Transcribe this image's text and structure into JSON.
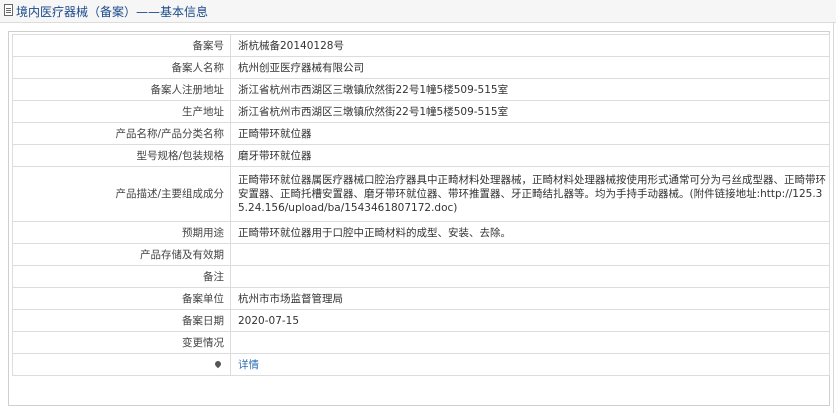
{
  "header": {
    "title": "境内医疗器械（备案）——基本信息"
  },
  "rows": [
    {
      "label": "备案号",
      "value": "浙杭械备20140128号"
    },
    {
      "label": "备案人名称",
      "value": "杭州创亚医疗器械有限公司"
    },
    {
      "label": "备案人注册地址",
      "value": "浙江省杭州市西湖区三墩镇欣然街22号1幢5楼509-515室"
    },
    {
      "label": "生产地址",
      "value": "浙江省杭州市西湖区三墩镇欣然街22号1幢5楼509-515室"
    },
    {
      "label": "产品名称/产品分类名称",
      "value": "正畸带环就位器"
    },
    {
      "label": "型号规格/包装规格",
      "value": "磨牙带环就位器"
    },
    {
      "label": "产品描述/主要组成成分",
      "value": "正畸带环就位器属医疗器械口腔治疗器具中正畸材料处理器械，正畸材料处理器械按使用形式通常可分为弓丝成型器、正畸带环安置器、正畸托槽安置器、磨牙带环就位器、带环推置器、牙正畸结扎器等。均为手持手动器械。(附件链接地址:http://125.35.24.156/upload/ba/1543461807172.doc)"
    },
    {
      "label": "预期用途",
      "value": "正畸带环就位器用于口腔中正畸材料的成型、安装、去除。"
    },
    {
      "label": "产品存储及有效期",
      "value": ""
    },
    {
      "label": "备注",
      "value": ""
    },
    {
      "label": "备案单位",
      "value": "杭州市市场监督管理局"
    },
    {
      "label": "备案日期",
      "value": "2020-07-15"
    },
    {
      "label": "变更情况",
      "value": ""
    }
  ],
  "detail": {
    "icon": "pin-icon",
    "link_text": "详情"
  }
}
